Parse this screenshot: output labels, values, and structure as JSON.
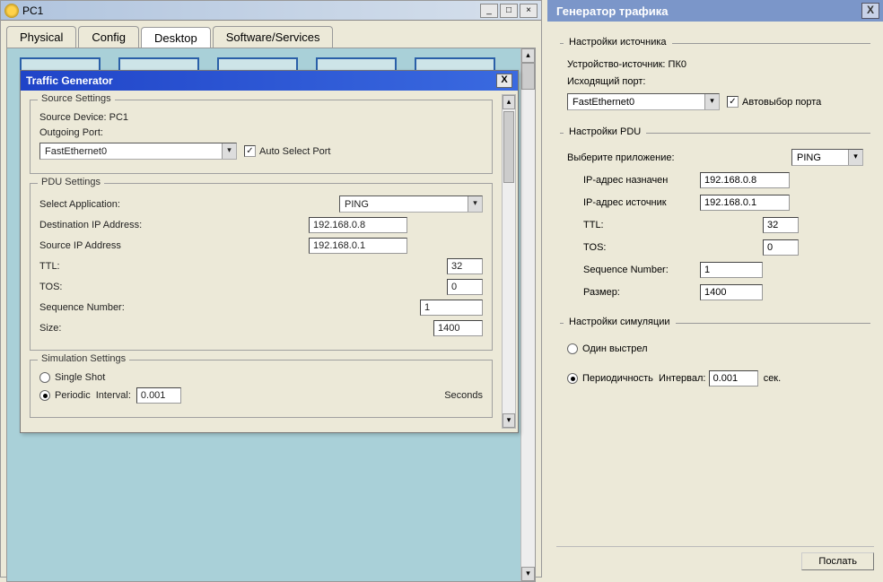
{
  "left_window": {
    "title": "PC1",
    "tabs": [
      "Physical",
      "Config",
      "Desktop",
      "Software/Services"
    ],
    "active_tab": "Desktop"
  },
  "traffic_gen": {
    "title": "Traffic Generator",
    "source_settings": {
      "legend": "Source Settings",
      "device_label": "Source Device:",
      "device_value": "PC1",
      "port_label": "Outgoing Port:",
      "port_value": "FastEthernet0",
      "auto_select_label": "Auto Select Port"
    },
    "pdu_settings": {
      "legend": "PDU Settings",
      "app_label": "Select Application:",
      "app_value": "PING",
      "dest_label": "Destination IP Address:",
      "dest_value": "192.168.0.8",
      "src_label": "Source IP Address",
      "src_value": "192.168.0.1",
      "ttl_label": "TTL:",
      "ttl_value": "32",
      "tos_label": "TOS:",
      "tos_value": "0",
      "seq_label": "Sequence Number:",
      "seq_value": "1",
      "size_label": "Size:",
      "size_value": "1400"
    },
    "sim_settings": {
      "legend": "Simulation Settings",
      "single_label": "Single Shot",
      "periodic_label": "Periodic",
      "interval_label": "Interval:",
      "interval_value": "0.001",
      "interval_unit": "Seconds"
    }
  },
  "right_window": {
    "title": "Генератор трафика",
    "source": {
      "legend": "Настройки источника",
      "device_label": "Устройство-источник:",
      "device_value": "ПК0",
      "port_label": "Исходящий порт:",
      "port_value": "FastEthernet0",
      "auto_label": "Автовыбор порта"
    },
    "pdu": {
      "legend": "Настройки PDU",
      "app_label": "Выберите приложение:",
      "app_value": "PING",
      "dest_label": "IP-адрес назначен",
      "dest_value": "192.168.0.8",
      "src_label": "IP-адрес источник",
      "src_value": "192.168.0.1",
      "ttl_label": "TTL:",
      "ttl_value": "32",
      "tos_label": "TOS:",
      "tos_value": "0",
      "seq_label": "Sequence Number:",
      "seq_value": "1",
      "size_label": "Размер:",
      "size_value": "1400"
    },
    "sim": {
      "legend": "Настройки симуляции",
      "single_label": "Один выстрел",
      "periodic_label": "Периодичность",
      "interval_label": "Интервал:",
      "interval_value": "0.001",
      "interval_unit": "сек."
    },
    "send_button": "Послать"
  }
}
